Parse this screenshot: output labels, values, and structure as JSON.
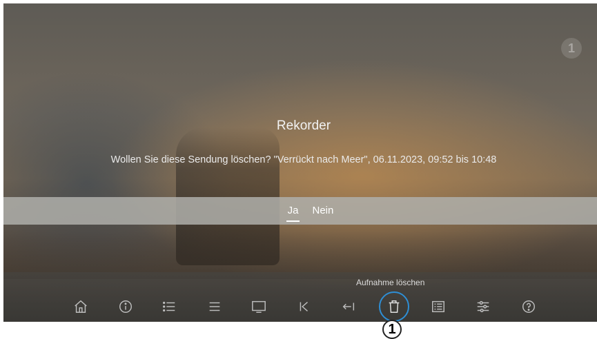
{
  "dialog": {
    "title": "Rekorder",
    "message": "Wollen Sie diese Sendung löschen? \"Verrückt nach Meer\", 06.11.2023, 09:52 bis 10:48",
    "options": [
      {
        "label": "Ja",
        "selected": true
      },
      {
        "label": "Nein",
        "selected": false
      }
    ]
  },
  "menu": {
    "focused_caption": "Aufnahme löschen",
    "icons": [
      "home-icon",
      "info-icon",
      "list-icon",
      "menu-icon",
      "tv-icon",
      "skip-back-icon",
      "back-arrow-icon",
      "trash-icon",
      "teletext-icon",
      "settings-sliders-icon",
      "help-icon"
    ]
  },
  "annotation": {
    "callout_number": "1"
  },
  "colors": {
    "focus_ring": "#2e8fd6"
  }
}
